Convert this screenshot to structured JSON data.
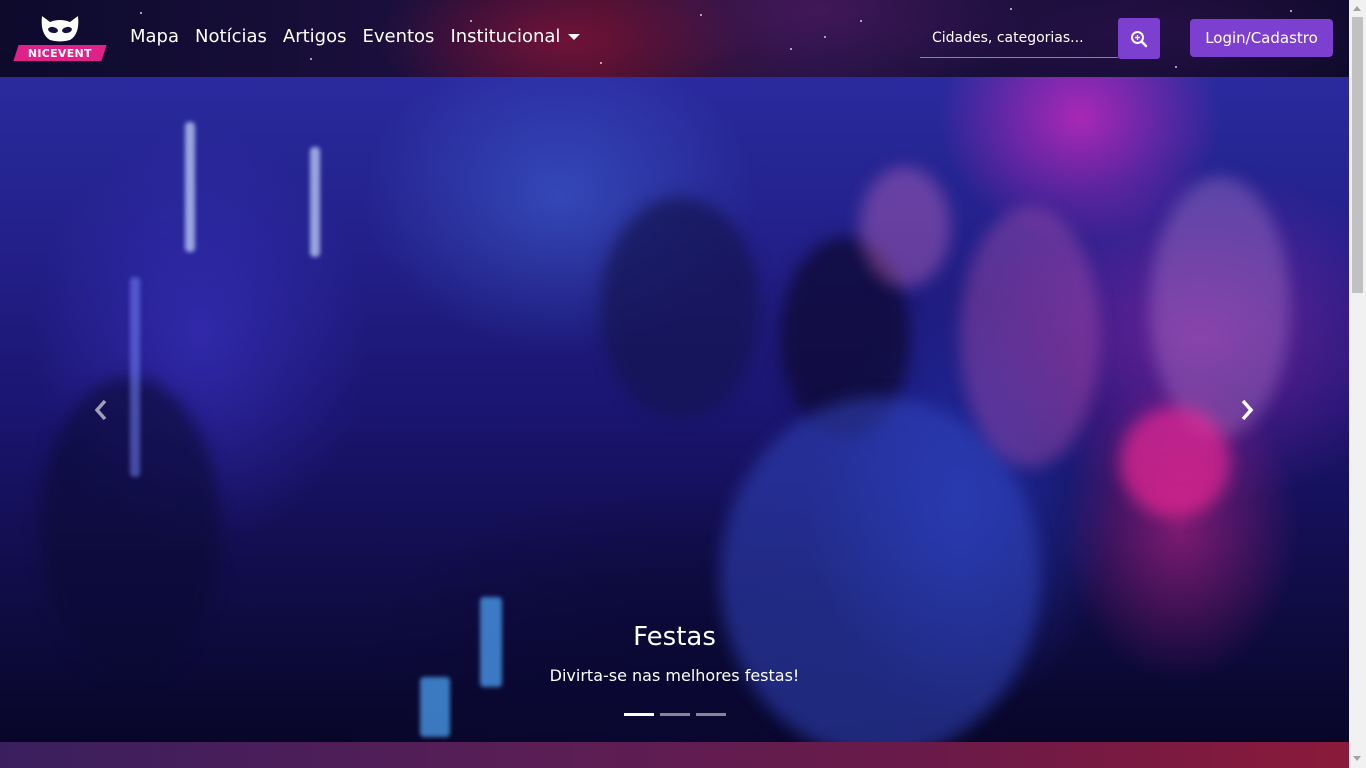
{
  "brand": {
    "name": "NICEVENT",
    "accent": "#e0218a"
  },
  "nav": {
    "items": [
      {
        "label": "Mapa"
      },
      {
        "label": "Notícias"
      },
      {
        "label": "Artigos"
      },
      {
        "label": "Eventos"
      },
      {
        "label": "Institucional",
        "dropdown": true
      }
    ]
  },
  "search": {
    "placeholder": "Cidades, categorias...",
    "icon": "search-icon"
  },
  "login": {
    "label": "Login/Cadastro"
  },
  "carousel": {
    "slide_title": "Festas",
    "slide_text": "Divirta-se nas melhores festas!",
    "slide_count": 3,
    "active_index": 0,
    "prev_icon": "chevron-left-icon",
    "next_icon": "chevron-right-icon"
  },
  "colors": {
    "button": "#7d3fd0",
    "brand_pink": "#e0218a"
  }
}
